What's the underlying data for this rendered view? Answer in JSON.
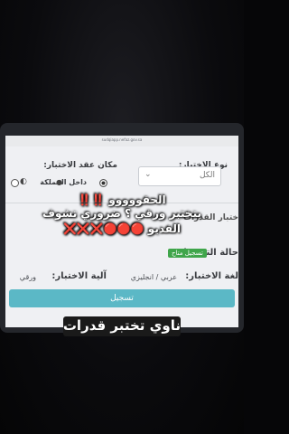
{
  "browser": {
    "url": "sudqiapp.nefaz.gov.sa"
  },
  "form": {
    "exam_type_label": "نوع الاختبار:",
    "exam_type_value": "الكل",
    "exam_location_label": "مكان عقد الاختبار:",
    "location_option_inside": "داخل المملكة",
    "test_name_partial": "ختبار القدرات",
    "registration_status_label": "حالة التسجيل:",
    "registration_status_badge": "تسجيل متاح",
    "exam_language_label": "لغة الاختبار:",
    "exam_language_value": "عربي / انجليزي",
    "exam_mechanism_label": "آلية الاختبار:",
    "exam_mechanism_value": "ورقي",
    "register_button": "تسجيل"
  },
  "overlay": {
    "line1": "الحقووووو ‼️‼️",
    "line2": "بتختبر ورقي ؟ ضروري تشوف",
    "line3": "الفديو 🔴🔴🔴❌❌❌",
    "caption": "ناوي تختبر قدرات"
  },
  "colors": {
    "register_button": "#5bb8c6",
    "status_badge": "#3fa54a"
  }
}
